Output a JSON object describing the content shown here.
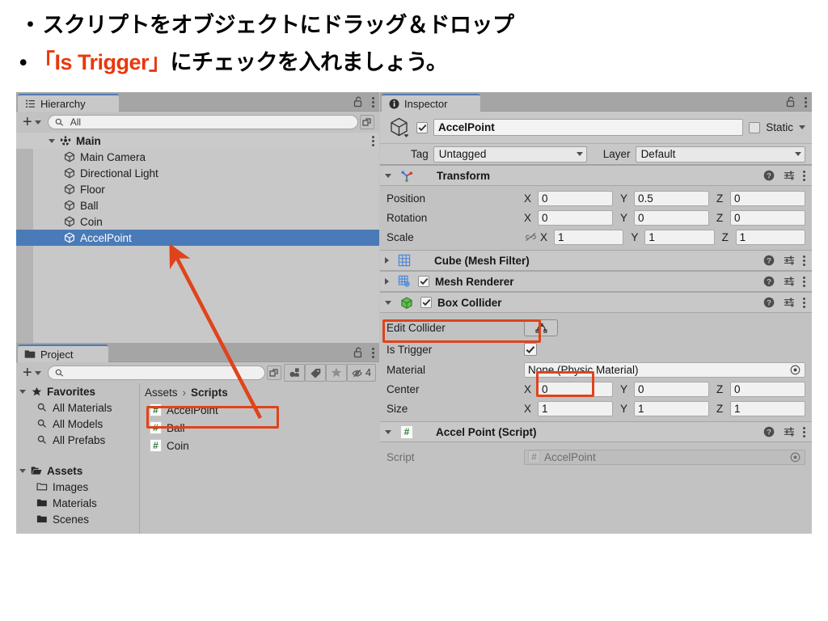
{
  "slide": {
    "bullet1_marker": "・",
    "bullet1": "スクリプトをオブジェクトにドラッグ＆ドロップ",
    "bullet2_marker": "•",
    "bullet2_red": "「Is Trigger」",
    "bullet2_rest": " にチェックを入れましょう。",
    "accent_red": "#e8380d"
  },
  "hierarchy": {
    "tab_label": "Hierarchy",
    "tab_icon": "hierarchy-icon",
    "lock_icon": "lock-open-icon",
    "menu_icon": "kebab-menu-icon",
    "add_label": "+",
    "search_placeholder": "All",
    "search_value": "All",
    "search_icon": "search-icon",
    "expand_icon": "expand-window-icon",
    "root": {
      "label": "Main",
      "icon": "unity-prefab-icon",
      "expanded": true
    },
    "items": [
      {
        "label": "Main Camera",
        "icon": "gameobject-icon",
        "selected": false
      },
      {
        "label": "Directional Light",
        "icon": "gameobject-icon",
        "selected": false
      },
      {
        "label": "Floor",
        "icon": "gameobject-icon",
        "selected": false
      },
      {
        "label": "Ball",
        "icon": "gameobject-icon",
        "selected": false
      },
      {
        "label": "Coin",
        "icon": "gameobject-icon",
        "selected": false
      },
      {
        "label": "AccelPoint",
        "icon": "gameobject-icon",
        "selected": true
      }
    ],
    "selection_color": "#4a7ab8"
  },
  "project": {
    "tab_label": "Project",
    "tab_icon": "folder-icon",
    "lock_icon": "lock-open-icon",
    "menu_icon": "kebab-menu-icon",
    "add_label": "+",
    "search_value": "",
    "search_icon": "search-icon",
    "toolbar_icons": [
      "search-by-type-icon",
      "search-by-label-icon",
      "favorites-star-icon",
      "hidden-packages-icon"
    ],
    "hidden_count": "4",
    "tree": [
      {
        "label": "Favorites",
        "icon": "star-icon",
        "bold": true,
        "indent": 0,
        "arrow": true
      },
      {
        "label": "All Materials",
        "icon": "search-small-icon",
        "bold": false,
        "indent": 1
      },
      {
        "label": "All Models",
        "icon": "search-small-icon",
        "bold": false,
        "indent": 1
      },
      {
        "label": "All Prefabs",
        "icon": "search-small-icon",
        "bold": false,
        "indent": 1
      },
      {
        "label": "",
        "icon": "",
        "bold": false,
        "indent": 0
      },
      {
        "label": "Assets",
        "icon": "folder-open-icon",
        "bold": true,
        "indent": 0,
        "arrow": true
      },
      {
        "label": "Images",
        "icon": "folder-empty-icon",
        "bold": false,
        "indent": 1
      },
      {
        "label": "Materials",
        "icon": "folder-icon",
        "bold": false,
        "indent": 1
      },
      {
        "label": "Scenes",
        "icon": "folder-icon",
        "bold": false,
        "indent": 1
      }
    ],
    "breadcrumb": {
      "root": "Assets",
      "sep": "›",
      "current": "Scripts"
    },
    "assets": [
      {
        "label": "AccelPoint",
        "icon": "csharp-script-icon",
        "highlighted": true
      },
      {
        "label": "Ball",
        "icon": "csharp-script-icon",
        "highlighted": false
      },
      {
        "label": "Coin",
        "icon": "csharp-script-icon",
        "highlighted": false
      }
    ]
  },
  "inspector": {
    "tab_label": "Inspector",
    "tab_icon": "info-icon",
    "lock_icon": "lock-open-icon",
    "menu_icon": "kebab-menu-icon",
    "object_icon": "gameobject-cube-icon",
    "enabled": true,
    "name": "AccelPoint",
    "static_label": "Static",
    "static_checked": false,
    "tag_label": "Tag",
    "tag_value": "Untagged",
    "layer_label": "Layer",
    "layer_value": "Default",
    "components": [
      {
        "name": "Transform",
        "icon": "transform-axis-icon",
        "expanded": true,
        "has_toggle": false,
        "highlight": false,
        "actions": [
          "help-icon",
          "preset-icon",
          "kebab-menu-icon"
        ],
        "rows": [
          {
            "type": "vector3",
            "label": "Position",
            "x": "0",
            "y": "0.5",
            "z": "0"
          },
          {
            "type": "vector3",
            "label": "Rotation",
            "x": "0",
            "y": "0",
            "z": "0"
          },
          {
            "type": "vector3",
            "label": "Scale",
            "x": "1",
            "y": "1",
            "z": "1",
            "lock_icon": "constrain-proportions-off-icon"
          }
        ]
      },
      {
        "name": "Cube (Mesh Filter)",
        "icon": "mesh-filter-icon",
        "expanded": false,
        "has_toggle": false,
        "highlight": false,
        "actions": [
          "help-icon",
          "preset-icon",
          "kebab-menu-icon"
        ],
        "rows": []
      },
      {
        "name": "Mesh Renderer",
        "icon": "mesh-renderer-icon",
        "expanded": false,
        "has_toggle": true,
        "toggle_checked": true,
        "highlight": false,
        "actions": [
          "help-icon",
          "preset-icon",
          "kebab-menu-icon"
        ],
        "rows": []
      },
      {
        "name": "Box Collider",
        "icon": "box-collider-icon",
        "expanded": true,
        "has_toggle": true,
        "toggle_checked": true,
        "highlight": true,
        "actions": [
          "help-icon",
          "preset-icon",
          "kebab-menu-icon"
        ],
        "rows": [
          {
            "type": "button",
            "label": "Edit Collider",
            "button_icon": "edit-collider-icon"
          },
          {
            "type": "checkbox",
            "label": "Is Trigger",
            "checked": true,
            "highlight": true
          },
          {
            "type": "object",
            "label": "Material",
            "value": "None (Physic Material)",
            "picker_icon": "object-picker-icon"
          },
          {
            "type": "vector3",
            "label": "Center",
            "x": "0",
            "y": "0",
            "z": "0"
          },
          {
            "type": "vector3",
            "label": "Size",
            "x": "1",
            "y": "1",
            "z": "1"
          }
        ]
      },
      {
        "name": "Accel Point (Script)",
        "icon": "csharp-script-icon",
        "expanded": true,
        "has_toggle": false,
        "highlight": false,
        "actions": [
          "help-icon",
          "preset-icon",
          "kebab-menu-icon"
        ],
        "rows": [
          {
            "type": "object-dim",
            "label": "Script",
            "value": "AccelPoint",
            "value_icon": "csharp-script-icon",
            "picker_icon": "object-picker-icon"
          }
        ]
      }
    ]
  },
  "annotations": {
    "arrow_color": "#e0431c",
    "arrow_name": "drag-drop-arrow",
    "box_color": "#e0431c"
  }
}
